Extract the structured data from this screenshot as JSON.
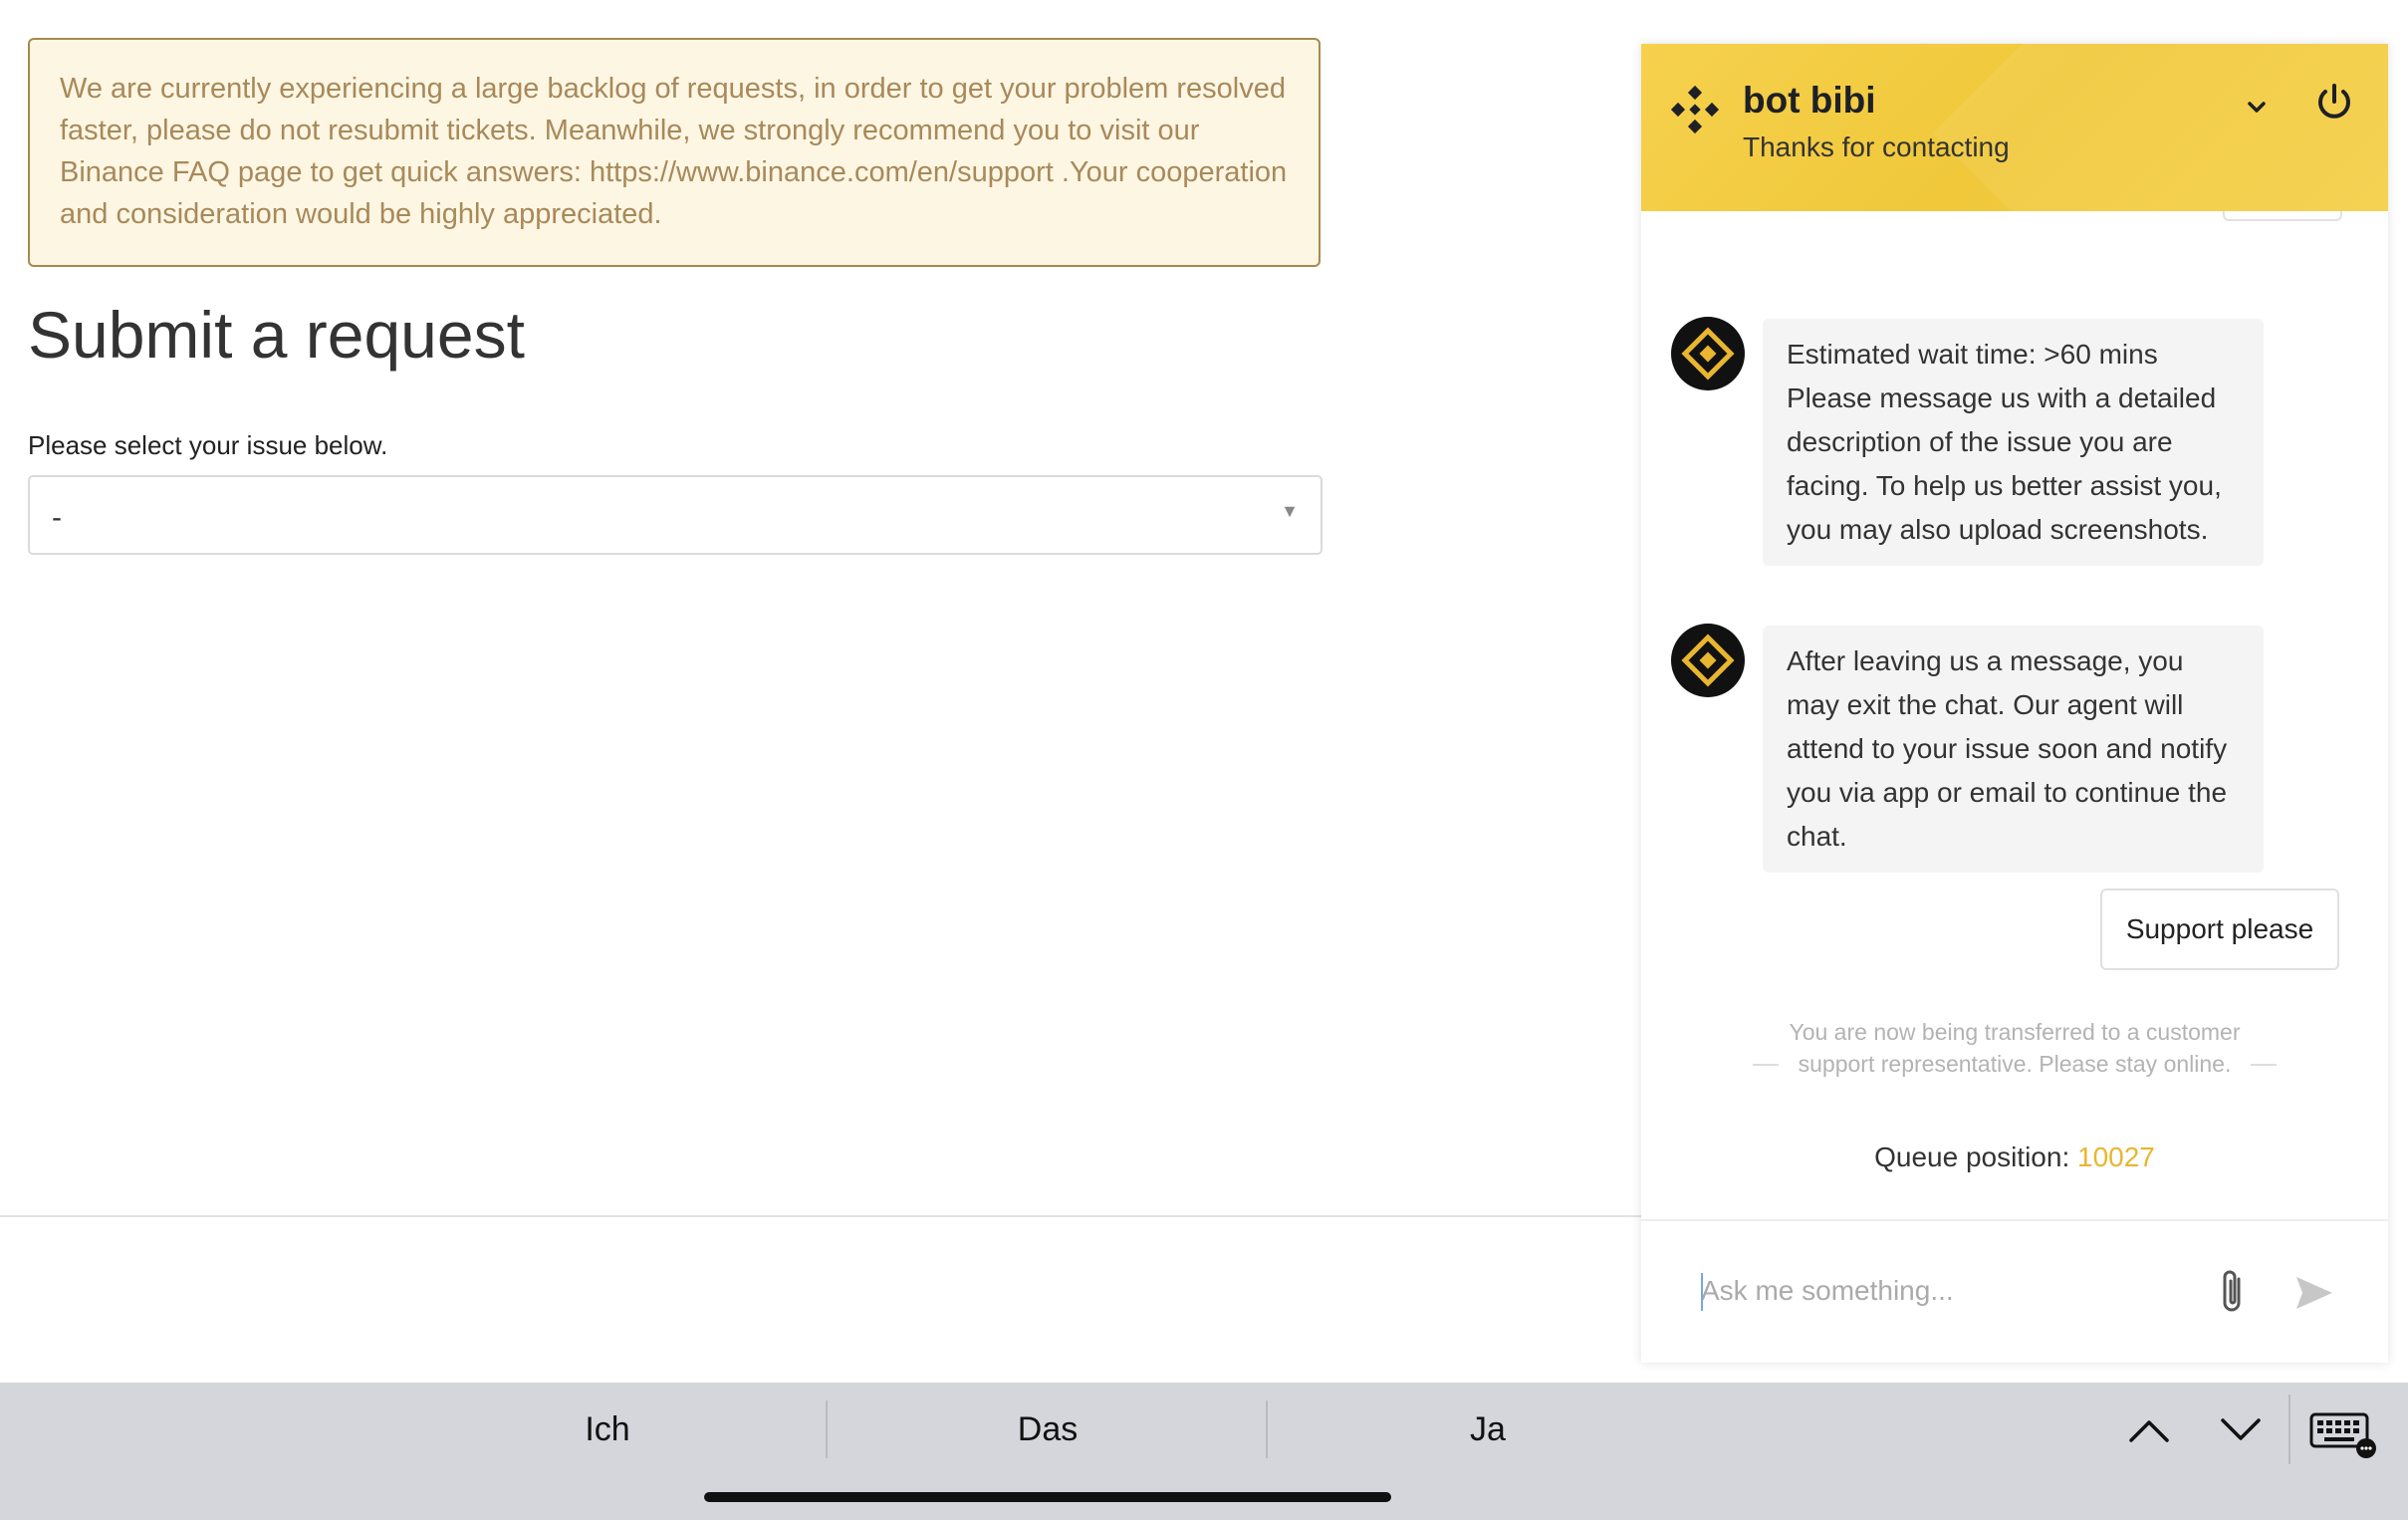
{
  "notice": {
    "text": "We are currently experiencing a large backlog of requests, in order to get your problem resolved faster, please do not resubmit tickets. Meanwhile, we strongly recommend you to visit our Binance FAQ page to get quick answers: https://www.binance.com/en/support .Your cooperation and consideration would be highly appreciated."
  },
  "form": {
    "title": "Submit a request",
    "select_label": "Please select your issue below.",
    "select_value": "-"
  },
  "chat": {
    "header": {
      "name": "bot bibi",
      "subtitle": "Thanks for contacting"
    },
    "messages": [
      {
        "text": "Estimated wait time: >60 mins Please message us with a detailed description of the issue you are facing. To help us better assist you, you may also upload screenshots."
      },
      {
        "text": "After leaving us a message, you may exit the chat. Our agent will attend to your issue soon and notify you via app or email to continue the chat."
      }
    ],
    "user_reply": "Support please",
    "system_message": "You are now being transferred to a customer support representative. Please stay online.",
    "queue_label": "Queue position:",
    "queue_number": "10027",
    "input_placeholder": "Ask me something..."
  },
  "keyboard": {
    "suggestions": [
      "Ich",
      "Das",
      "Ja"
    ]
  },
  "colors": {
    "brand_yellow": "#f0c83a",
    "queue_number": "#e8b62f",
    "notice_bg": "#fdf6e3",
    "notice_border": "#a68a4e"
  },
  "icons": {
    "header_logo": "binance-logo-icon",
    "minimize": "chevron-down-icon",
    "close": "power-icon",
    "attach": "paperclip-icon",
    "send": "send-icon",
    "keyboard": "keyboard-icon"
  }
}
